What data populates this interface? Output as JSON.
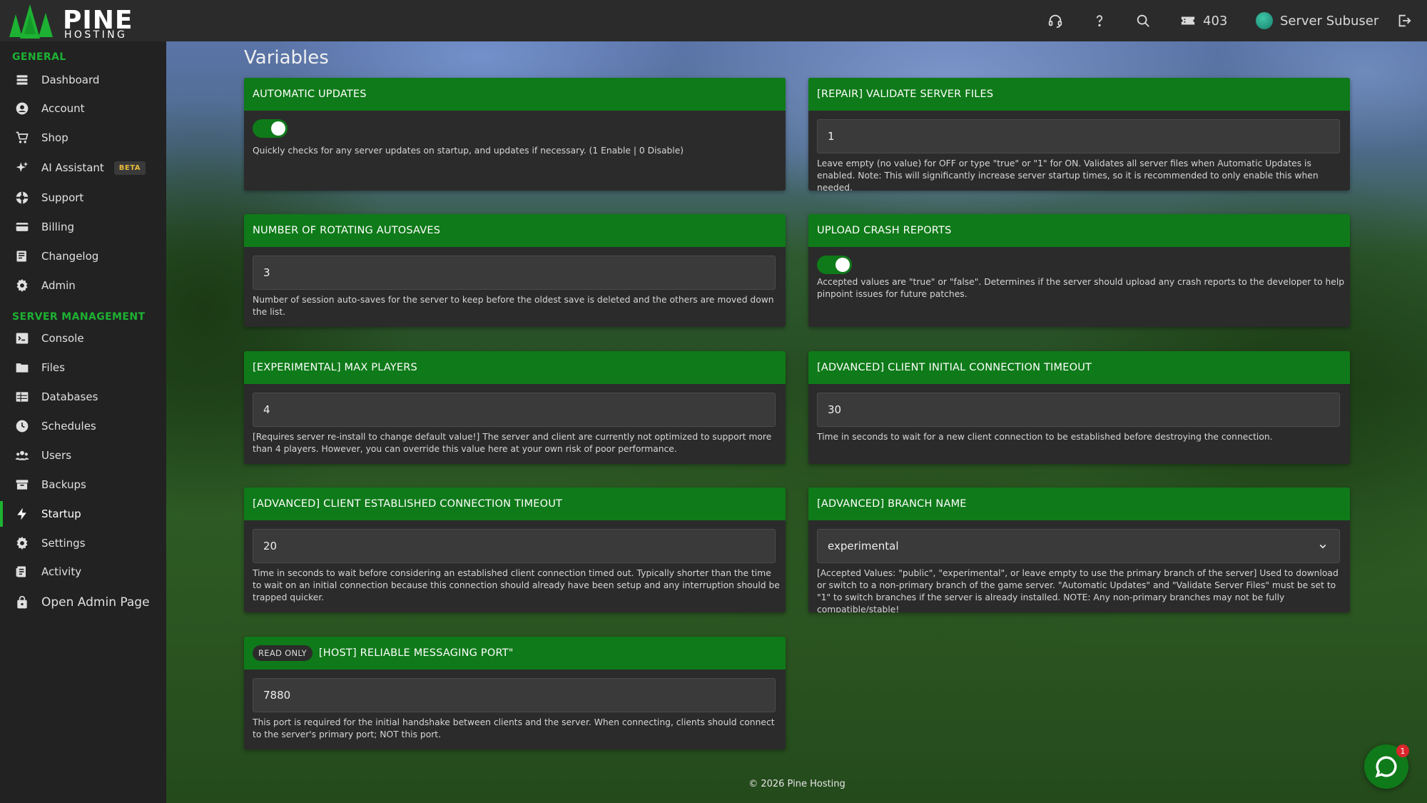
{
  "brand": {
    "name": "PINE",
    "sub": "HOSTING",
    "accent": "#1db233",
    "header_green": "#0f7a19"
  },
  "topbar": {
    "credits": "403",
    "user_name": "Server Subuser"
  },
  "sidebar": {
    "general_heading": "GENERAL",
    "general": [
      {
        "label": "Dashboard",
        "icon": "dashboard-icon"
      },
      {
        "label": "Account",
        "icon": "account-icon"
      },
      {
        "label": "Shop",
        "icon": "cart-icon"
      },
      {
        "label": "AI Assistant",
        "icon": "sparkle-icon",
        "badge": "BETA"
      },
      {
        "label": "Support",
        "icon": "support-icon"
      },
      {
        "label": "Billing",
        "icon": "billing-icon"
      },
      {
        "label": "Changelog",
        "icon": "changelog-icon"
      },
      {
        "label": "Admin",
        "icon": "gear-icon"
      }
    ],
    "server_heading": "SERVER MANAGEMENT",
    "server": [
      {
        "label": "Console",
        "icon": "terminal-icon"
      },
      {
        "label": "Files",
        "icon": "folder-icon"
      },
      {
        "label": "Databases",
        "icon": "table-icon"
      },
      {
        "label": "Schedules",
        "icon": "clock-icon"
      },
      {
        "label": "Users",
        "icon": "users-icon"
      },
      {
        "label": "Backups",
        "icon": "archive-icon"
      },
      {
        "label": "Startup",
        "icon": "bolt-icon",
        "active": true
      },
      {
        "label": "Settings",
        "icon": "gear-icon"
      },
      {
        "label": "Activity",
        "icon": "activity-icon"
      }
    ],
    "open_admin": "Open Admin Page"
  },
  "page": {
    "title": "Variables"
  },
  "cards": {
    "auto_updates": {
      "title": "AUTOMATIC UPDATES",
      "toggle_on": true,
      "description": "Quickly checks for any server updates on startup, and updates if necessary. (1 Enable | 0 Disable)"
    },
    "validate_files": {
      "title": "[REPAIR] VALIDATE SERVER FILES",
      "value": "1",
      "description": "Leave empty (no value) for OFF or type \"true\" or \"1\" for ON. Validates all server files when Automatic Updates is enabled. Note: This will significantly increase server startup times, so it is recommended to only enable this when needed."
    },
    "autosaves": {
      "title": "NUMBER OF ROTATING AUTOSAVES",
      "value": "3",
      "description": "Number of session auto-saves for the server to keep before the oldest save is deleted and the others are moved down the list."
    },
    "crash_reports": {
      "title": "UPLOAD CRASH REPORTS",
      "toggle_on": true,
      "description": "Accepted values are \"true\" or \"false\". Determines if the server should upload any crash reports to the developer to help pinpoint issues for future patches."
    },
    "max_players": {
      "title": "[EXPERIMENTAL] MAX PLAYERS",
      "value": "4",
      "description": "[Requires server re-install to change default value!] The server and client are currently not optimized to support more than 4 players. However, you can override this value here at your own risk of poor performance."
    },
    "initial_timeout": {
      "title": "[ADVANCED] CLIENT INITIAL CONNECTION TIMEOUT",
      "value": "30",
      "description": "Time in seconds to wait for a new client connection to be established before destroying the connection."
    },
    "established_timeout": {
      "title": "[ADVANCED] CLIENT ESTABLISHED CONNECTION TIMEOUT",
      "value": "20",
      "description": "Time in seconds to wait before considering an established client connection timed out. Typically shorter than the time to wait on an initial connection because this connection should already have been setup and any interruption should be trapped quicker."
    },
    "branch_name": {
      "title": "[ADVANCED] BRANCH NAME",
      "value": "experimental",
      "description": "[Accepted Values: \"public\", \"experimental\", or leave empty to use the primary branch of the server] Used to download or switch to a non-primary branch of the game server. \"Automatic Updates\" and \"Validate Server Files\" must be set to \"1\" to switch branches if the server is already installed. NOTE: Any non-primary branches may not be fully compatible/stable!"
    },
    "messaging_port": {
      "badge": "READ ONLY",
      "title": "[HOST] RELIABLE MESSAGING PORT\"",
      "value": "7880",
      "description": "This port is required for the initial handshake between clients and the server. When connecting, clients should connect to the server's primary port; NOT this port."
    }
  },
  "footer": {
    "text": "© 2026 Pine Hosting"
  },
  "chat": {
    "unread": "1"
  }
}
